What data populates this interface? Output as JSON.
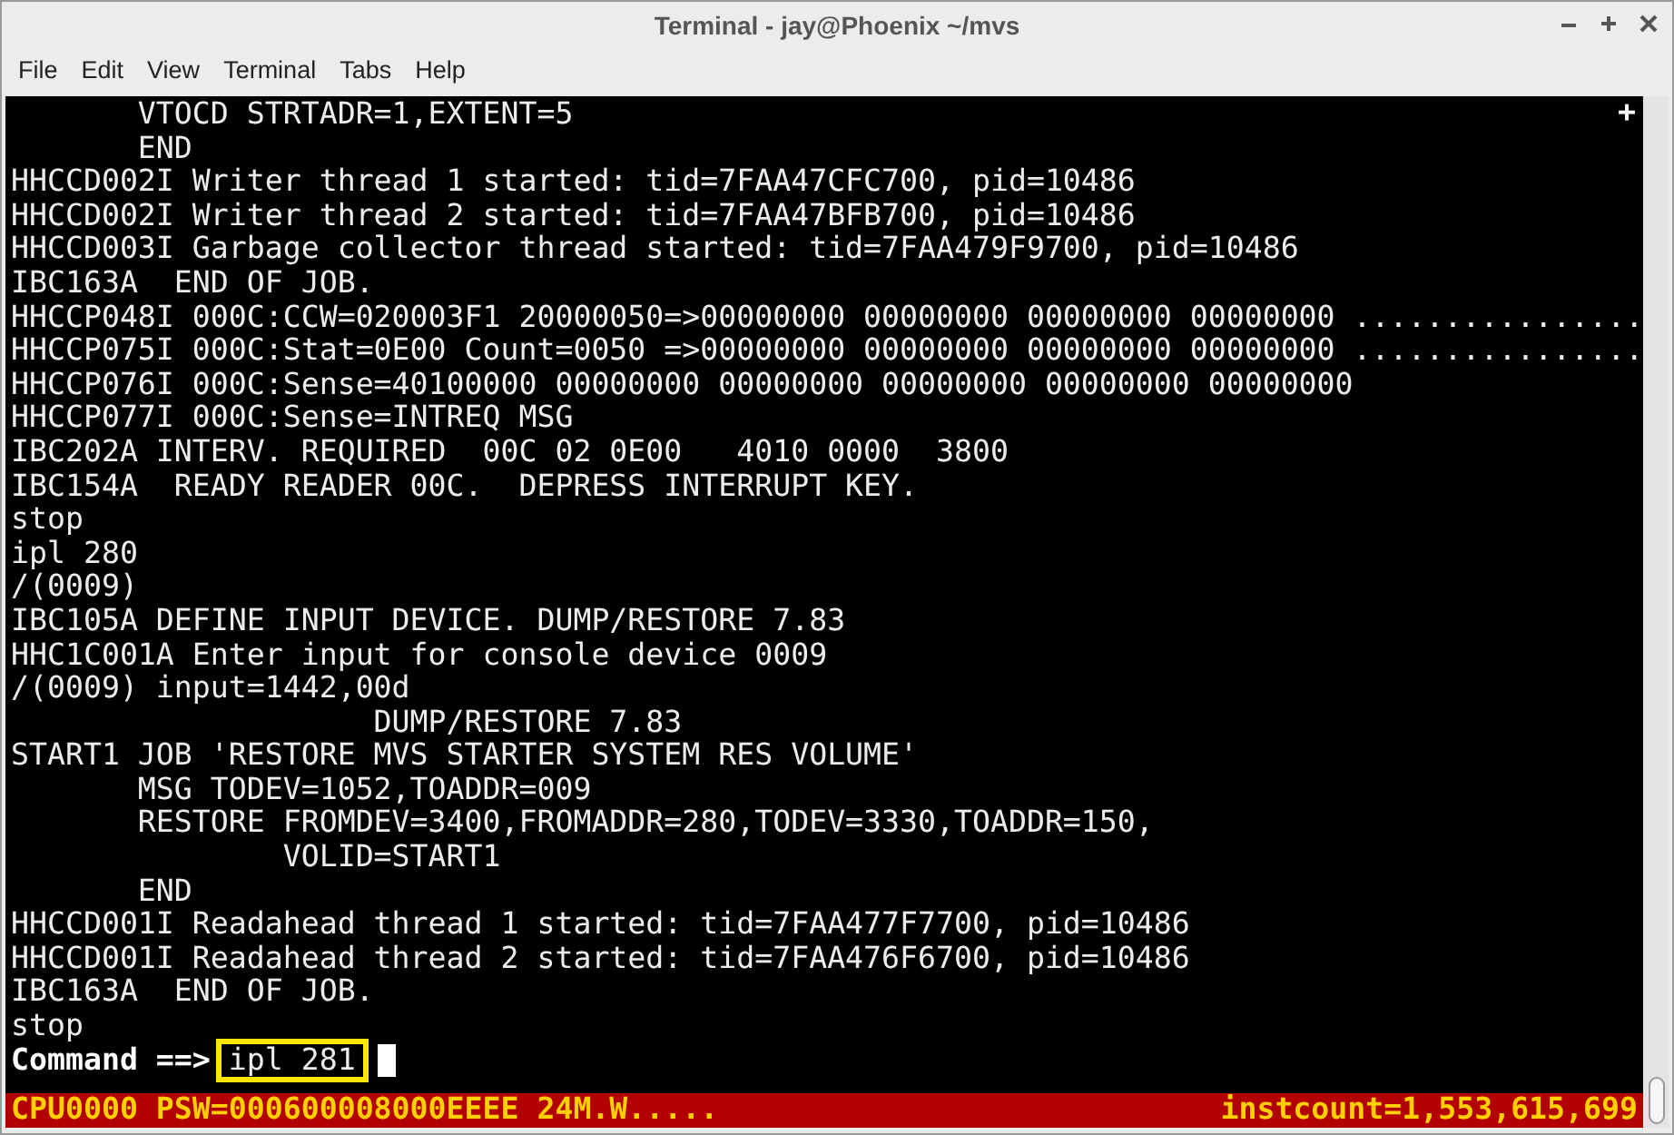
{
  "window": {
    "title": "Terminal - jay@Phoenix ~/mvs"
  },
  "menu": [
    "File",
    "Edit",
    "View",
    "Terminal",
    "Tabs",
    "Help"
  ],
  "terminal": {
    "marker": "+",
    "lines": [
      "       VTOCD STRTADR=1,EXTENT=5",
      "       END",
      "HHCCD002I Writer thread 1 started: tid=7FAA47CFC700, pid=10486",
      "HHCCD002I Writer thread 2 started: tid=7FAA47BFB700, pid=10486",
      "HHCCD003I Garbage collector thread started: tid=7FAA479F9700, pid=10486",
      "IBC163A  END OF JOB.",
      "HHCCP048I 000C:CCW=020003F1 20000050=>00000000 00000000 00000000 00000000 ................",
      "HHCCP075I 000C:Stat=0E00 Count=0050 =>00000000 00000000 00000000 00000000 ................",
      "HHCCP076I 000C:Sense=40100000 00000000 00000000 00000000 00000000 00000000",
      "HHCCP077I 000C:Sense=INTREQ MSG",
      "IBC202A INTERV. REQUIRED  00C 02 0E00   4010 0000  3800",
      "IBC154A  READY READER 00C.  DEPRESS INTERRUPT KEY.",
      "stop",
      "ipl 280",
      "/(0009)",
      "IBC105A DEFINE INPUT DEVICE. DUMP/RESTORE 7.83",
      "HHC1C001A Enter input for console device 0009",
      "/(0009) input=1442,00d",
      "                    DUMP/RESTORE 7.83",
      "START1 JOB 'RESTORE MVS STARTER SYSTEM RES VOLUME'",
      "       MSG TODEV=1052,TOADDR=009",
      "       RESTORE FROMDEV=3400,FROMADDR=280,TODEV=3330,TOADDR=150,",
      "               VOLID=START1",
      "       END",
      "HHCCD001I Readahead thread 1 started: tid=7FAA477F7700, pid=10486",
      "HHCCD001I Readahead thread 2 started: tid=7FAA476F6700, pid=10486",
      "IBC163A  END OF JOB.",
      "stop"
    ],
    "command": {
      "prompt": "Command ==>",
      "value": "ipl 281",
      "highlighted": true
    },
    "status": {
      "left": "CPU0000 PSW=000600008000EEEE 24M.W.....",
      "right": "instcount=1,553,615,699"
    }
  }
}
